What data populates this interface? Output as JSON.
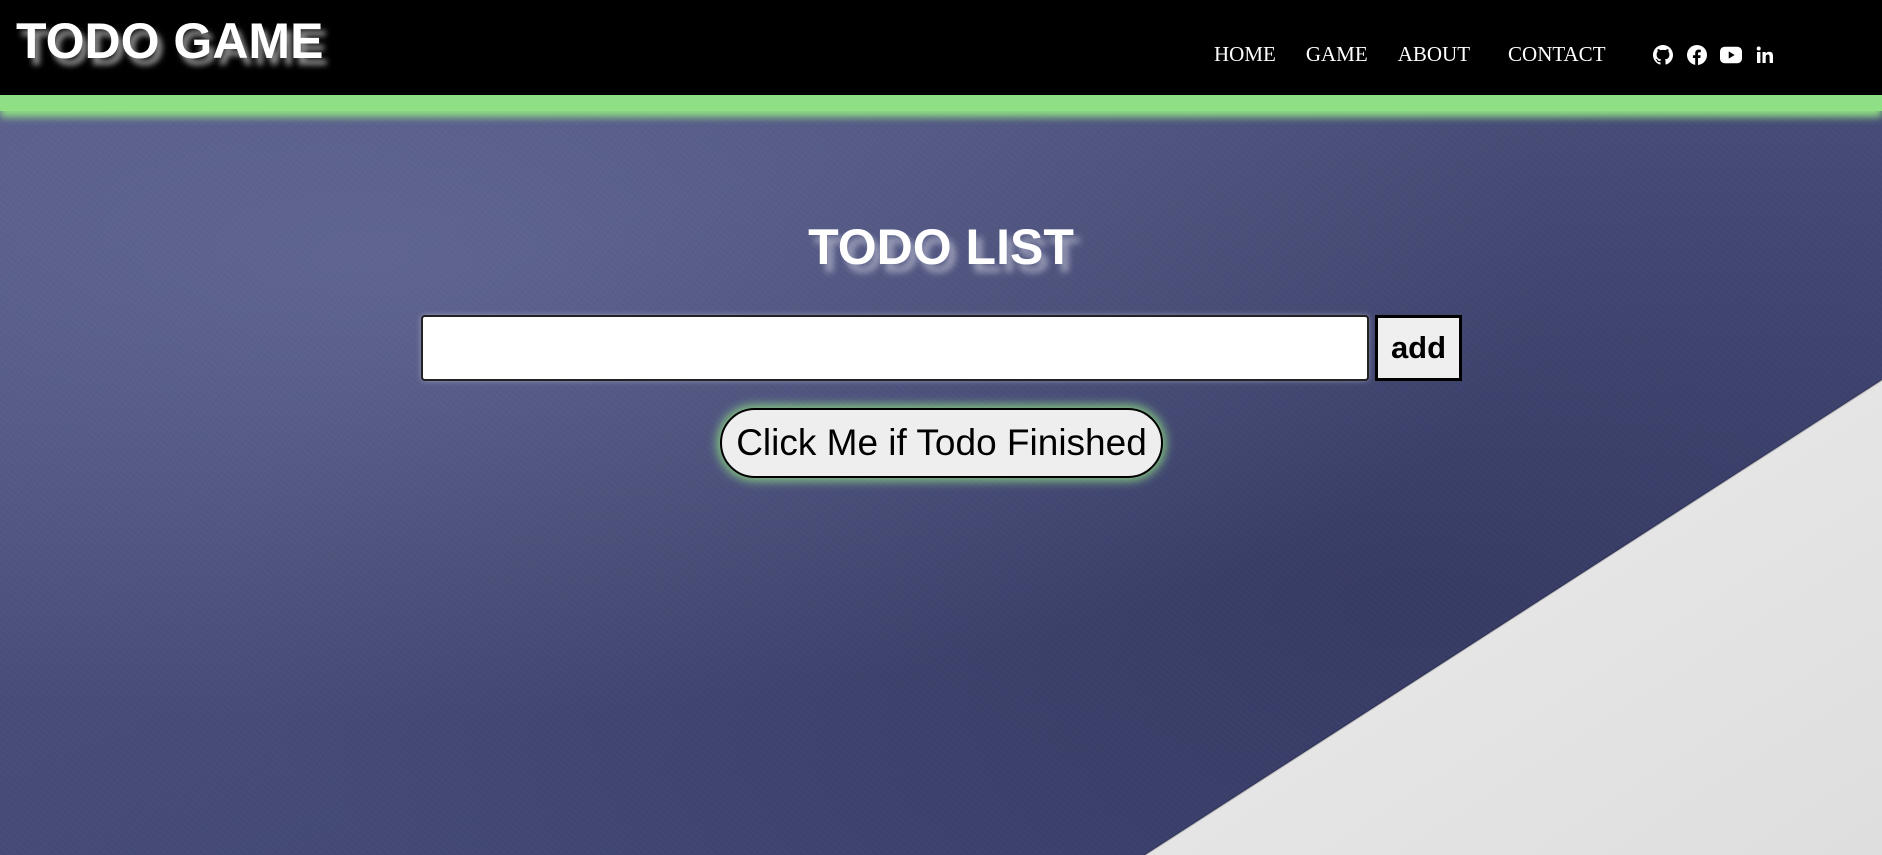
{
  "colors": {
    "header_bg": "#000000",
    "accent_green": "#8fdc84",
    "background_navy": "#4a4f78",
    "paper_white": "#e8e8e8",
    "button_bg": "#eeeeee"
  },
  "header": {
    "logo": "TODO GAME",
    "nav": [
      {
        "label": "HOME"
      },
      {
        "label": "GAME"
      },
      {
        "label": "ABOUT"
      },
      {
        "label": "CONTACT"
      }
    ],
    "social_icons": [
      "github-icon",
      "facebook-icon",
      "youtube-icon",
      "linkedin-icon"
    ]
  },
  "main": {
    "title": "TODO LIST",
    "todo_input": {
      "value": "",
      "placeholder": ""
    },
    "add_label": "add",
    "finish_label": "Click Me if Todo Finished"
  }
}
